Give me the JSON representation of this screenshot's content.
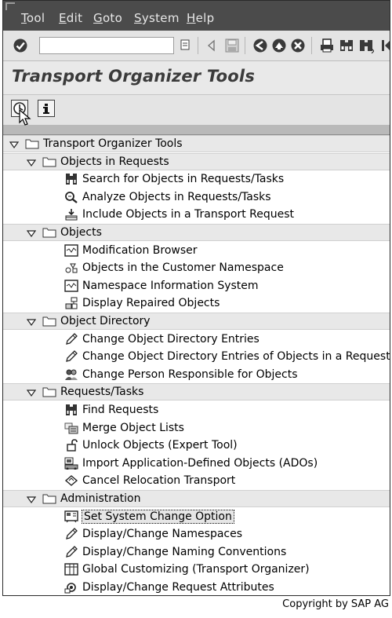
{
  "menubar": {
    "items": [
      {
        "label": "Tool",
        "key": "T"
      },
      {
        "label": "Edit",
        "key": "E"
      },
      {
        "label": "Goto",
        "key": "G"
      },
      {
        "label": "System",
        "key": "S"
      },
      {
        "label": "Help",
        "key": "H"
      }
    ]
  },
  "toolbar": {
    "command_field_value": "",
    "buttons": [
      "enter-icon",
      "dropdown-icon",
      "back-arrow-icon",
      "save-icon",
      "back-icon",
      "exit-icon",
      "cancel-icon",
      "print-icon",
      "find-icon",
      "find-next-icon"
    ]
  },
  "page": {
    "title": "Transport Organizer Tools"
  },
  "app_toolbar": {
    "buttons": [
      "execute-icon",
      "info-icon"
    ]
  },
  "tree": {
    "root": {
      "label": "Transport Organizer Tools"
    },
    "groups": [
      {
        "label": "Objects in Requests",
        "items": [
          {
            "label": "Search for Objects in Requests/Tasks",
            "icon": "binoculars-icon"
          },
          {
            "label": "Analyze Objects in Requests/Tasks",
            "icon": "magnifier-icon"
          },
          {
            "label": "Include Objects in a Transport Request",
            "icon": "include-icon"
          }
        ]
      },
      {
        "label": "Objects",
        "items": [
          {
            "label": "Modification Browser",
            "icon": "program-icon"
          },
          {
            "label": "Objects in the Customer Namespace",
            "icon": "objects-icon"
          },
          {
            "label": "Namespace Information System",
            "icon": "program-icon"
          },
          {
            "label": "Display Repaired Objects",
            "icon": "tree-structure-icon"
          }
        ]
      },
      {
        "label": "Object Directory",
        "items": [
          {
            "label": "Change Object Directory Entries",
            "icon": "pencil-icon"
          },
          {
            "label": "Change Object Directory Entries of Objects in a Request",
            "icon": "pencil-icon"
          },
          {
            "label": "Change Person Responsible for Objects",
            "icon": "people-icon"
          }
        ]
      },
      {
        "label": "Requests/Tasks",
        "items": [
          {
            "label": "Find Requests",
            "icon": "binoculars-icon"
          },
          {
            "label": "Merge Object Lists",
            "icon": "merge-icon"
          },
          {
            "label": "Unlock Objects (Expert Tool)",
            "icon": "unlock-icon"
          },
          {
            "label": "Import Application-Defined Objects (ADOs)",
            "icon": "import-icon"
          },
          {
            "label": "Cancel Relocation Transport",
            "icon": "cancel-transport-icon"
          }
        ]
      },
      {
        "label": "Administration",
        "items": [
          {
            "label": "Set System Change Option",
            "icon": "system-change-icon",
            "selected": true
          },
          {
            "label": "Display/Change Namespaces",
            "icon": "pencil-icon"
          },
          {
            "label": "Display/Change Naming Conventions",
            "icon": "pencil-icon"
          },
          {
            "label": "Global Customizing (Transport Organizer)",
            "icon": "table-icon"
          },
          {
            "label": "Display/Change Request Attributes",
            "icon": "attributes-icon"
          }
        ]
      }
    ]
  },
  "footer": {
    "copyright": "Copyright by SAP AG"
  }
}
